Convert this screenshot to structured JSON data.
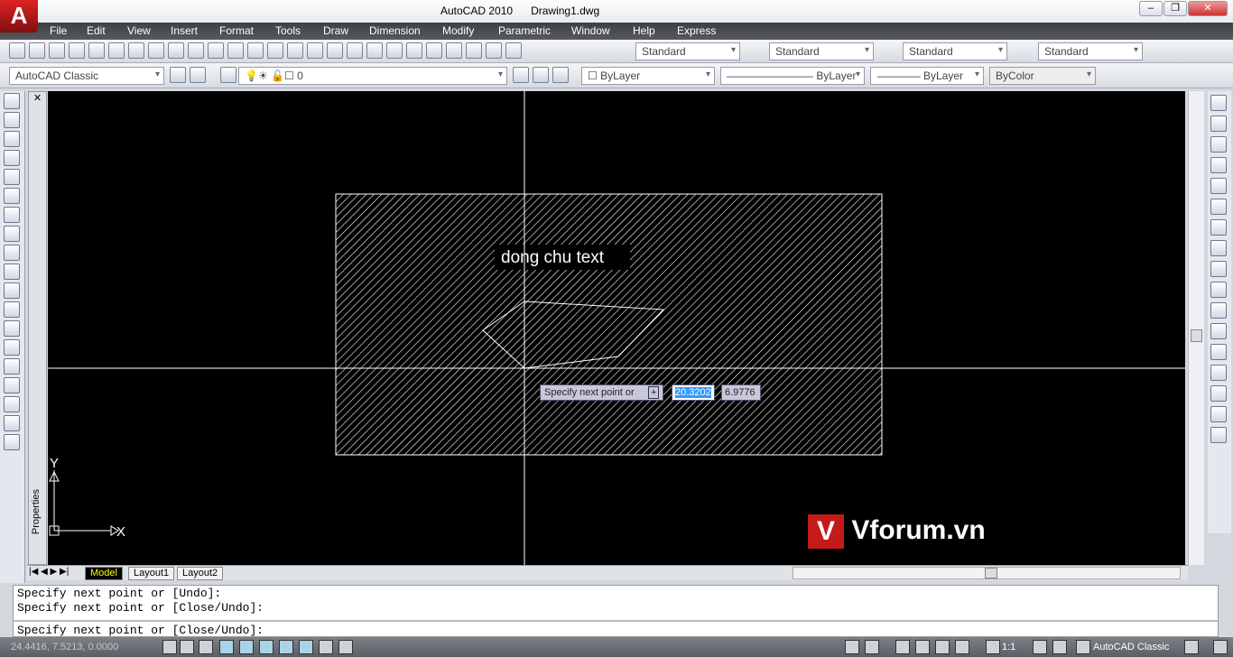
{
  "app": {
    "title": "AutoCAD 2010",
    "document": "Drawing1.dwg",
    "logo": "A"
  },
  "window_controls": [
    "minimize",
    "restore",
    "close"
  ],
  "menu": [
    "File",
    "Edit",
    "View",
    "Insert",
    "Format",
    "Tools",
    "Draw",
    "Dimension",
    "Modify",
    "Parametric",
    "Window",
    "Help",
    "Express"
  ],
  "toolbar1": {
    "icons": [
      "new-icon",
      "open-icon",
      "save-icon",
      "print-icon",
      "plot-preview-icon",
      "publish-icon",
      "3d-dwf-icon",
      "sheet-set-icon",
      "cut-icon",
      "copy-icon",
      "paste-icon",
      "match-properties-icon",
      "block-editor-icon",
      "undo-icon",
      "redo-icon",
      "pan-icon",
      "zoom-realtime-icon",
      "zoom-window-icon",
      "zoom-previous-icon",
      "properties-icon",
      "design-center-icon",
      "tool-palettes-icon",
      "sheet-set-manager-icon",
      "markup-icon",
      "quickcalc-icon",
      "help-icon"
    ],
    "styles": [
      "Standard",
      "Standard",
      "Standard",
      "Standard"
    ]
  },
  "toolbar2": {
    "workspace": "AutoCAD Classic",
    "layer": "0",
    "color": "ByLayer",
    "linetype": "ByLayer",
    "lineweight": "ByLayer",
    "plotstyle": "ByColor"
  },
  "left_tools": [
    "line-icon",
    "construction-line-icon",
    "polyline-icon",
    "polygon-icon",
    "rectangle-icon",
    "arc-icon",
    "circle-icon",
    "revision-cloud-icon",
    "spline-icon",
    "ellipse-icon",
    "ellipse-arc-icon",
    "insert-block-icon",
    "make-block-icon",
    "point-icon",
    "hatch-icon",
    "gradient-icon",
    "region-icon",
    "table-icon",
    "multiline-text-icon"
  ],
  "right_tools": [
    "erase-icon",
    "copy-object-icon",
    "mirror-icon",
    "offset-icon",
    "array-icon",
    "move-icon",
    "rotate-icon",
    "scale-icon",
    "stretch-icon",
    "trim-icon",
    "extend-icon",
    "break-at-point-icon",
    "break-icon",
    "join-icon",
    "chamfer-icon",
    "fillet-icon",
    "explode-icon"
  ],
  "properties_label": "Properties",
  "drawing": {
    "text": "dong chu text",
    "ucs_x": "X",
    "ucs_y": "Y"
  },
  "dynamic_input": {
    "prompt": "Specify next point or",
    "value1": "20.3202",
    "value2": "6.9776"
  },
  "tabs": [
    "Model",
    "Layout1",
    "Layout2"
  ],
  "command": {
    "history": [
      "Specify next point or [Undo]:",
      "Specify next point or [Close/Undo]:"
    ],
    "current": "Specify next point or [Close/Undo]:"
  },
  "status": {
    "coords": "24.4416, 7.5213, 0.0000",
    "scale": "1:1",
    "workspace": "AutoCAD Classic"
  },
  "watermark": "Vforum.vn",
  "colors": {
    "canvas": "#000000",
    "menubar": "#4a4d52",
    "accent": "#c41a1a"
  }
}
